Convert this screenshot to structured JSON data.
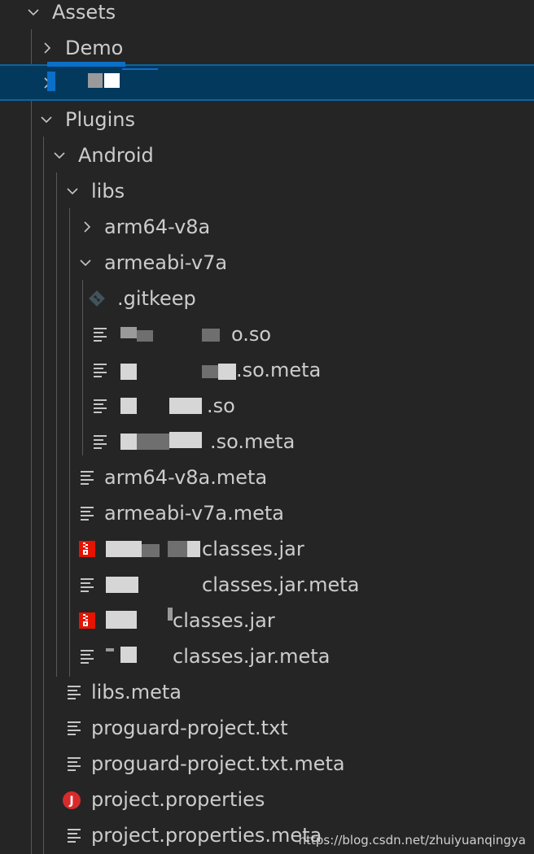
{
  "explorer": {
    "items": [
      {
        "label": "Assets"
      },
      {
        "label": "Demo"
      },
      {
        "label": ""
      },
      {
        "label": "Plugins"
      },
      {
        "label": "Android"
      },
      {
        "label": "libs"
      },
      {
        "label": "arm64-v8a"
      },
      {
        "label": "armeabi-v7a"
      },
      {
        "label": ".gitkeep"
      },
      {
        "label": "o.so"
      },
      {
        "label": ".so.meta"
      },
      {
        "label": ".so"
      },
      {
        "label": ".so.meta"
      },
      {
        "label": "arm64-v8a.meta"
      },
      {
        "label": "armeabi-v7a.meta"
      },
      {
        "label": "classes.jar"
      },
      {
        "label": "classes.jar.meta"
      },
      {
        "label": "classes.jar"
      },
      {
        "label": "classes.jar.meta"
      },
      {
        "label": "libs.meta"
      },
      {
        "label": "proguard-project.txt"
      },
      {
        "label": "proguard-project.txt.meta"
      },
      {
        "label": "project.properties"
      },
      {
        "label": "project.properties.meta"
      }
    ]
  },
  "watermark": "https://blog.csdn.net/zhuiyuanqingya",
  "colors": {
    "background": "#252526",
    "text": "#cccccc",
    "selection": "#04395e",
    "selection_border": "#0e639c",
    "jar_icon": "#e51400",
    "properties_icon": "#d92b2b",
    "git_icon": "#41535b"
  },
  "icons": {
    "expanded": "chevron-down-icon",
    "collapsed": "chevron-right-icon",
    "text_file": "lines-file-icon",
    "jar": "jar-file-icon",
    "git": "git-diamond-icon",
    "properties": "java-properties-icon"
  }
}
